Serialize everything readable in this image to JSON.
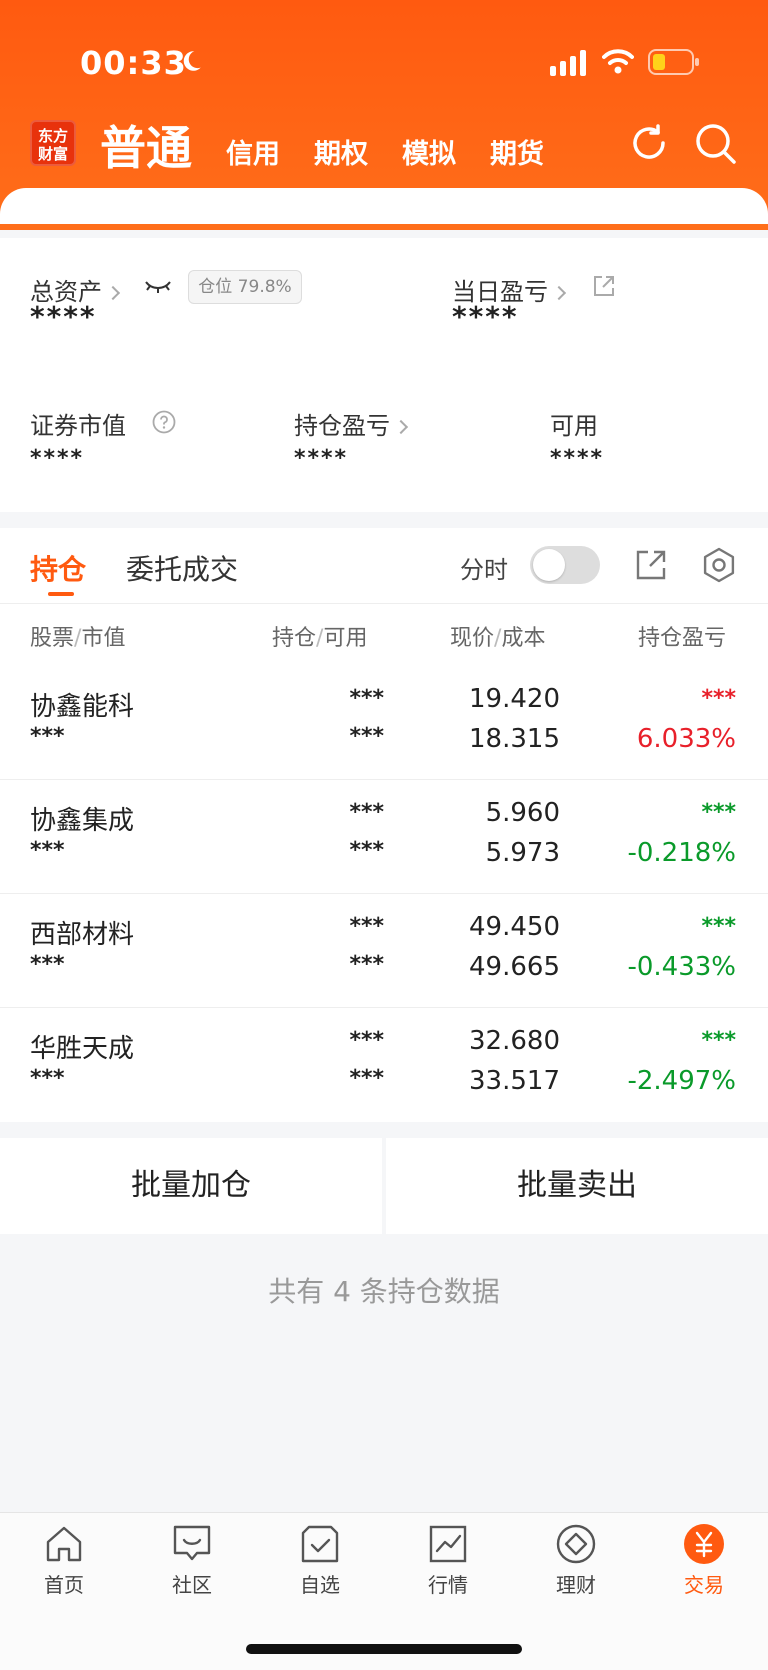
{
  "status_bar": {
    "time": "00:33"
  },
  "header": {
    "logo_line1": "东方",
    "logo_line2": "财富",
    "tabs": [
      {
        "label": "普通",
        "active": true
      },
      {
        "label": "信用"
      },
      {
        "label": "期权"
      },
      {
        "label": "模拟"
      },
      {
        "label": "期货"
      }
    ]
  },
  "assets": {
    "total_label": "总资产",
    "total_value": "****",
    "position_badge": "仓位 79.8%",
    "daily_pl_label": "当日盈亏",
    "daily_pl_value": "****",
    "market_value_label": "证券市值",
    "market_value_value": "****",
    "holding_pl_label": "持仓盈亏",
    "holding_pl_value": "****",
    "available_label": "可用",
    "available_value": "****"
  },
  "holdings": {
    "tab_active": "持仓",
    "tab_other": "委托成交",
    "fenshi_label": "分时",
    "columns": {
      "c1a": "股票",
      "c1b": "市值",
      "c2a": "持仓",
      "c2b": "可用",
      "c3a": "现价",
      "c3b": "成本",
      "c4": "持仓盈亏"
    },
    "rows": [
      {
        "name": "协鑫能科",
        "market_value": "***",
        "position": "***",
        "available": "***",
        "price": "19.420",
        "cost": "18.315",
        "pl": "***",
        "pl_pct": "6.033%",
        "dir": "up"
      },
      {
        "name": "协鑫集成",
        "market_value": "***",
        "position": "***",
        "available": "***",
        "price": "5.960",
        "cost": "5.973",
        "pl": "***",
        "pl_pct": "-0.218%",
        "dir": "down"
      },
      {
        "name": "西部材料",
        "market_value": "***",
        "position": "***",
        "available": "***",
        "price": "49.450",
        "cost": "49.665",
        "pl": "***",
        "pl_pct": "-0.433%",
        "dir": "down"
      },
      {
        "name": "华胜天成",
        "market_value": "***",
        "position": "***",
        "available": "***",
        "price": "32.680",
        "cost": "33.517",
        "pl": "***",
        "pl_pct": "-2.497%",
        "dir": "down"
      }
    ]
  },
  "actions": {
    "batch_add": "批量加仓",
    "batch_sell": "批量卖出"
  },
  "summary": "共有 4 条持仓数据",
  "tabbar": [
    {
      "label": "首页",
      "icon": "home-icon"
    },
    {
      "label": "社区",
      "icon": "community-icon"
    },
    {
      "label": "自选",
      "icon": "watchlist-icon"
    },
    {
      "label": "行情",
      "icon": "market-icon"
    },
    {
      "label": "理财",
      "icon": "wealth-icon"
    },
    {
      "label": "交易",
      "icon": "trade-icon",
      "active": true
    }
  ],
  "colors": {
    "brand": "#ff5a10",
    "up": "#e8202a",
    "down": "#0a9a2a"
  }
}
